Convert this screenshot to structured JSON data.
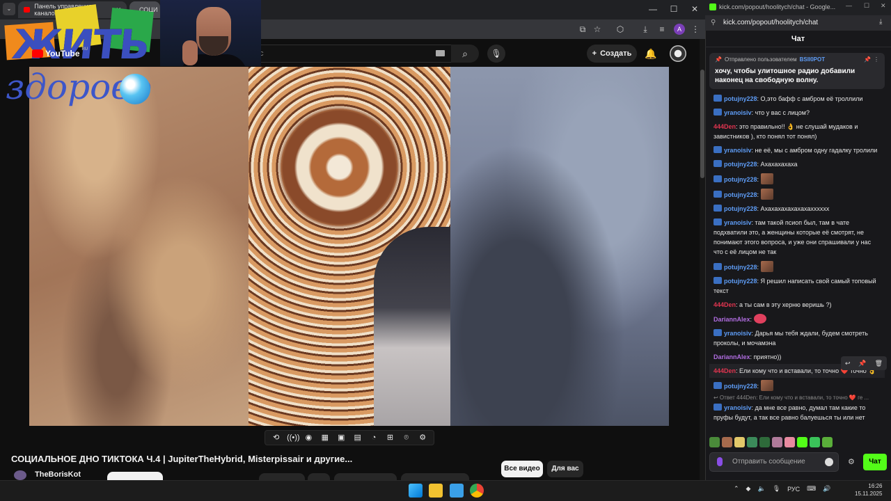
{
  "browser_left": {
    "tabs": [
      {
        "label": "Панель управления каналом"
      },
      {
        "label": "СОЦИ"
      }
    ],
    "controls": {
      "minimize": "—",
      "maximize": "☐",
      "close": "✕"
    }
  },
  "youtube": {
    "logo_text": "YouTube",
    "logo_region": "RU",
    "search_placeholder": "c",
    "create_label": "Создать",
    "video_title": "СОЦИАЛЬНОЕ ДНО ТИКТОКА Ч.4 | JupiterTheHybrid, Misterpissair и другие...",
    "channel_name": "TheBorisKot",
    "subscribe_label": "",
    "chips": [
      "Все видео",
      "Для вас"
    ],
    "player_controls": [
      "repeat-icon",
      "broadcast-icon",
      "eye-icon",
      "film-icon",
      "pip-icon",
      "subtitles-icon",
      "speed-icon",
      "add-icon",
      "screenshot-icon",
      "gear-icon"
    ]
  },
  "overlay": {
    "logo_line1": "ЖИТЬ",
    "logo_line2": "здорово"
  },
  "browser_right": {
    "tab_title": "kick.com/popout/hoolitych/chat - Google...",
    "url": "kick.com/popout/hoolitych/chat",
    "chat_title": "Чат",
    "pinned": {
      "meta": "Отправлено пользователем",
      "user": "BSII0POT",
      "text": "хочу, чтобы улитошное радио добавили наконец на свободную волну."
    },
    "messages": [
      {
        "user": "potujny228",
        "color": "#5e9cf5",
        "badge": true,
        "text": "О,это бафф с амбром её троллили"
      },
      {
        "user": "yranoisiv",
        "color": "#5e9cf5",
        "badge": true,
        "text": "что у вас с лицом?"
      },
      {
        "user": "444Den",
        "color": "#e0344f",
        "badge": false,
        "text": "это правильно!! 👌 не слушай мудаков и завистников ), кто понял тот понял)"
      },
      {
        "user": "yranoisiv",
        "color": "#5e9cf5",
        "badge": true,
        "text": "не её, мы с амбром одну гадалку тролили"
      },
      {
        "user": "potujny228",
        "color": "#5e9cf5",
        "badge": true,
        "text": "Ахахахахаха"
      },
      {
        "user": "potujny228",
        "color": "#5e9cf5",
        "badge": true,
        "text": "",
        "emote": true
      },
      {
        "user": "potujny228",
        "color": "#5e9cf5",
        "badge": true,
        "text": "",
        "emote": true
      },
      {
        "user": "potujny228",
        "color": "#5e9cf5",
        "badge": true,
        "text": "Ахахахахахахахахххххх"
      },
      {
        "user": "yranoisiv",
        "color": "#5e9cf5",
        "badge": true,
        "text": "там такой псиоп был, там в чате подхватили это, а женщины которые её смотрят, не понимают этого вопроса, и уже они спрашивали у нас что с её лицом не так"
      },
      {
        "user": "potujny228",
        "color": "#5e9cf5",
        "badge": true,
        "text": "",
        "emote": true
      },
      {
        "user": "potujny228",
        "color": "#5e9cf5",
        "badge": true,
        "text": "Я решил написать свой самый топовый текст"
      },
      {
        "user": "444Den",
        "color": "#e0344f",
        "badge": false,
        "text": "а ты сам в эту херню веришь ?)"
      },
      {
        "user": "DariannAlex",
        "color": "#b06de0",
        "badge": false,
        "text": "",
        "blob": true
      },
      {
        "user": "yranoisiv",
        "color": "#5e9cf5",
        "badge": true,
        "text": "Дарья мы тебя ждали, будем смотреть проколы, и мочамэна"
      },
      {
        "user": "DariannAlex",
        "color": "#b06de0",
        "badge": false,
        "text": "приятно))"
      },
      {
        "user": "444Den",
        "color": "#e0344f",
        "badge": false,
        "text": "Ели кому что и вставали, то точно ❤️ точно 👌",
        "hover": true
      },
      {
        "user": "potujny228",
        "color": "#5e9cf5",
        "badge": true,
        "text": "",
        "emote": true
      }
    ],
    "reply_line": "↩ Ответ 444Den: Ели кому что и вставали, то точно ❤️ ге ...",
    "last_message": {
      "user": "yranoisiv",
      "text": "да мне все равно, думал там какие то пруфы будут, а так все равно балуешься ты или нет"
    },
    "input_placeholder": "Отправить сообщение",
    "send_label": "Чат"
  },
  "taskbar": {
    "tray_lang": "РУС",
    "time": "16:26",
    "date": "15.11.2025"
  },
  "colors": {
    "kick_green": "#53fc18",
    "yt_red": "#ff0000",
    "chat_bg": "#18181b"
  }
}
